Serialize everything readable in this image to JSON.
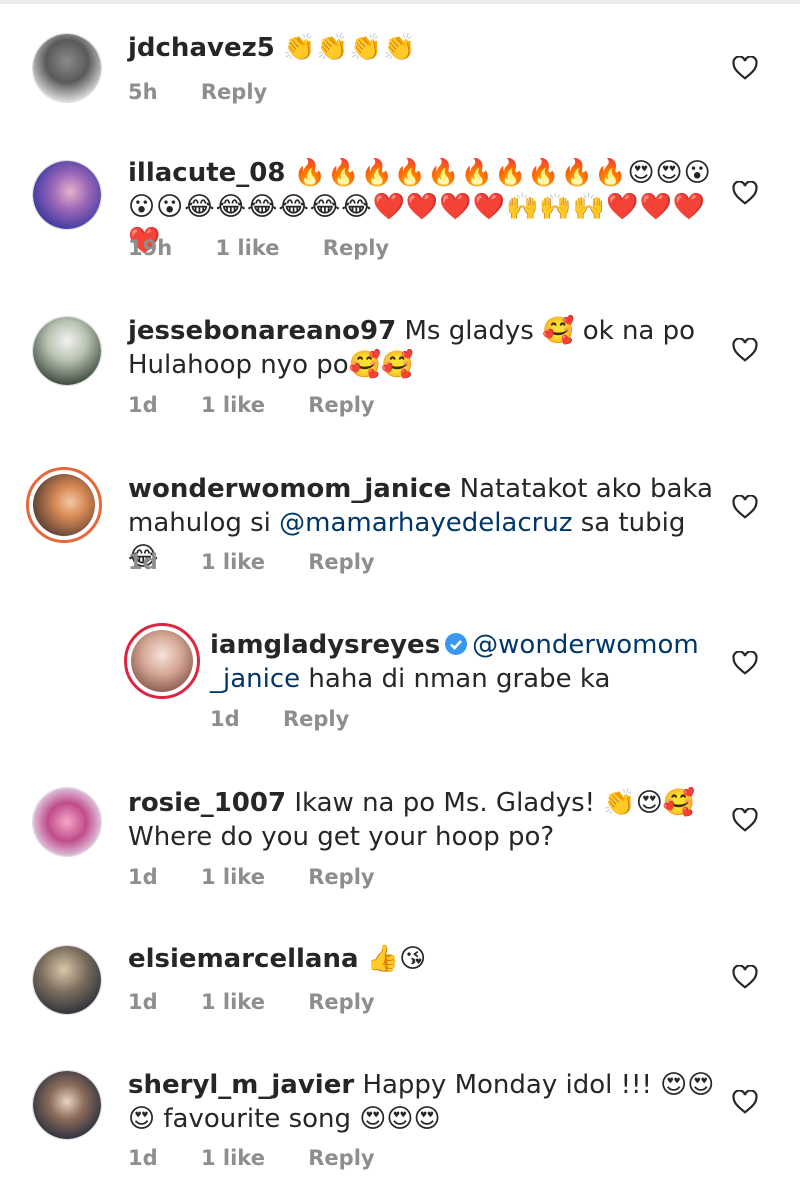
{
  "comments": [
    {
      "username": "jdchavez5",
      "text": "👏👏👏👏",
      "time": "5h",
      "likes": "",
      "reply_label": "Reply"
    },
    {
      "username": "illacute_08",
      "text": "🔥🔥🔥🔥🔥🔥🔥🔥🔥🔥😍😍😮😮😮😂😂😂😂😂😂❤️❤️❤️❤️🙌🙌🙌❤️❤️❤️❤️",
      "time": "19h",
      "likes": "1 like",
      "reply_label": "Reply"
    },
    {
      "username": "jessebonareano97",
      "text": "Ms gladys 🥰 ok na po Hulahoop nyo po🥰🥰",
      "time": "1d",
      "likes": "1 like",
      "reply_label": "Reply"
    },
    {
      "username": "wonderwomom_janice",
      "text_before": "Natatakot ako baka mahulog si ",
      "mention": "@mamarhayedelacruz",
      "text_after": "  sa tubig 😂",
      "time": "1d",
      "likes": "1 like",
      "reply_label": "Reply"
    },
    {
      "username": "iamgladysreyes",
      "mention": "@wonderwomom _janice",
      "text_after": " haha di nman grabe ka",
      "time": "1d",
      "likes": "",
      "reply_label": "Reply"
    },
    {
      "username": "rosie_1007",
      "text": "Ikaw na po Ms. Gladys! 👏😍🥰 Where do you get your hoop po?",
      "time": "1d",
      "likes": "1 like",
      "reply_label": "Reply"
    },
    {
      "username": "elsiemarcellana",
      "text": "👍😘",
      "time": "1d",
      "likes": "1 like",
      "reply_label": "Reply"
    },
    {
      "username": "sheryl_m_javier",
      "text": "Happy Monday idol !!! 😍😍😍 favourite song 😍😍😍",
      "time": "1d",
      "likes": "1 like",
      "reply_label": "Reply"
    }
  ],
  "icons": {
    "like": "heart-outline-icon",
    "verified": "verified-badge-icon"
  },
  "colors": {
    "meta": "#8e8e8e",
    "mention": "#00376b",
    "verified": "#3897f0",
    "ring": "#dc2743"
  }
}
